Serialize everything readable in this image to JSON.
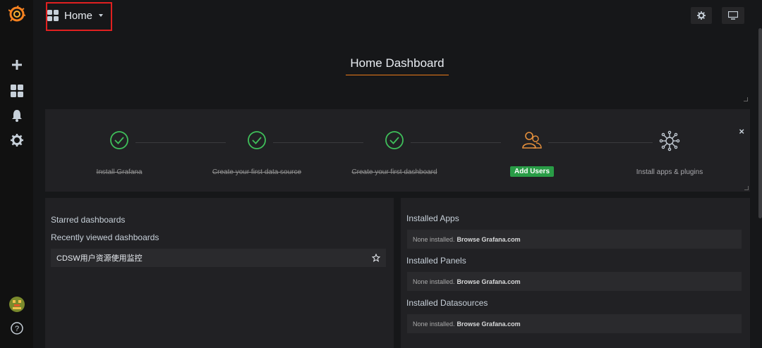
{
  "header": {
    "title": "Home"
  },
  "dashboard": {
    "title": "Home Dashboard"
  },
  "getting_started": {
    "steps": [
      {
        "label": "Install Grafana",
        "done": true
      },
      {
        "label": "Create your first data source",
        "done": true
      },
      {
        "label": "Create your first dashboard",
        "done": true
      },
      {
        "label": "Add Users",
        "done": false,
        "button": true
      },
      {
        "label": "Install apps & plugins",
        "done": false
      }
    ],
    "close": "×"
  },
  "left_panel": {
    "starred_title": "Starred dashboards",
    "recent_title": "Recently viewed dashboards",
    "recent_items": [
      {
        "name": "CDSW用户资源使用监控"
      }
    ]
  },
  "right_panel": {
    "sections": [
      {
        "title": "Installed Apps",
        "none_text": "None installed.",
        "link_text": "Browse Grafana.com"
      },
      {
        "title": "Installed Panels",
        "none_text": "None installed.",
        "link_text": "Browse Grafana.com"
      },
      {
        "title": "Installed Datasources",
        "none_text": "None installed.",
        "link_text": "Browse Grafana.com"
      }
    ]
  },
  "colors": {
    "accent": "#eb7b18",
    "success": "#299c46",
    "check_green": "#3fbf5a",
    "user_orange": "#e6903c"
  },
  "icons": {
    "sidebar": [
      "grafana-logo-icon",
      "plus-icon",
      "dashboards-icon",
      "bell-icon",
      "gear-icon",
      "avatar",
      "help-icon"
    ],
    "topbar": [
      "settings-icon",
      "tv-mode-icon"
    ]
  }
}
